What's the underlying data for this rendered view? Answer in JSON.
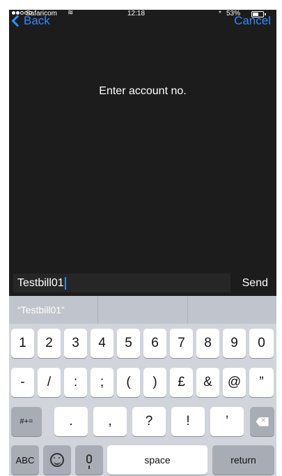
{
  "status_bar": {
    "carrier": "Safaricom",
    "time": "12:18",
    "battery": "53%",
    "bluetooth_symbol": "*",
    "signal_full_dots": 2,
    "signal_empty_dots": 3,
    "wifi_icon": "wifi-icon"
  },
  "nav": {
    "back_label": "Back",
    "cancel_label": "Cancel",
    "accent_color": "#2d8cff"
  },
  "prompt": "Enter account no.",
  "input": {
    "value": "Testbill01",
    "send_label": "Send"
  },
  "suggestions": [
    "“Testbill01”",
    "",
    ""
  ],
  "keyboard": {
    "row1": [
      "1",
      "2",
      "3",
      "4",
      "5",
      "6",
      "7",
      "8",
      "9",
      "0"
    ],
    "row2": [
      "-",
      "/",
      ":",
      ";",
      "(",
      ")",
      "£",
      "&",
      "@",
      "”"
    ],
    "row3": {
      "mode_label": "#+=",
      "keys": [
        ".",
        ",",
        "?",
        "!",
        "’"
      ],
      "backspace_icon": "backspace-icon"
    },
    "row4": {
      "abc_label": "ABC",
      "emoji_icon": "emoji-icon",
      "mic_icon": "microphone-icon",
      "space_label": "space",
      "return_label": "return"
    }
  }
}
